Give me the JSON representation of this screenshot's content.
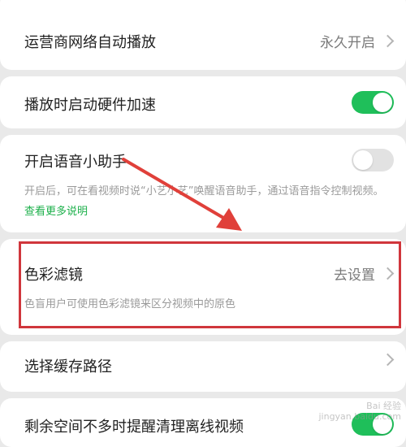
{
  "settings": {
    "carrier_autoplay": {
      "label": "运营商网络自动播放",
      "value": "永久开启"
    },
    "hw_accel": {
      "label": "播放时启动硬件加速",
      "enabled": true
    },
    "voice_assistant": {
      "label": "开启语音小助手",
      "enabled": false,
      "desc_part1": "开启后，可在看视频时说“小艺小艺”唤醒语音助手，通过语音指令控制视频。",
      "link": "查看更多说明"
    },
    "color_filter": {
      "label": "色彩滤镜",
      "action": "去设置",
      "desc": "色盲用户可使用色彩滤镜来区分视频中的原色"
    },
    "cache_path": {
      "label": "选择缓存路径"
    },
    "low_storage": {
      "label": "剩余空间不多时提醒清理离线视频",
      "enabled": true
    }
  },
  "watermark": {
    "line1": "Bai 经验",
    "line2": "jingyan.baidu.com"
  },
  "colors": {
    "toggle_on": "#1fbf5a",
    "toggle_off": "#e2e2e2",
    "highlight": "#d0363c",
    "link": "#1db04b",
    "arrow": "#e0403a"
  }
}
